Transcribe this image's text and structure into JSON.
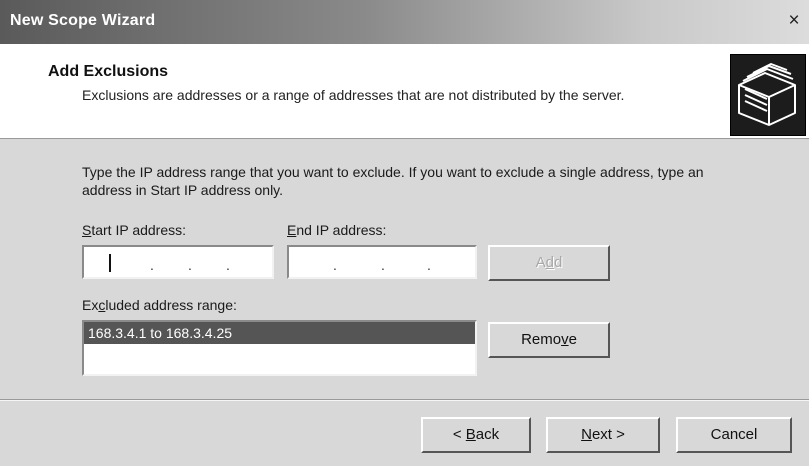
{
  "window": {
    "title": "New Scope Wizard",
    "close": "×"
  },
  "header": {
    "title": "Add Exclusions",
    "description": "Exclusions are addresses or a range of addresses that are not distributed by the server.",
    "icon": "folders-icon"
  },
  "instructions": "Type the IP address range that you want to exclude. If you want to exclude a single address, type an address in Start IP address only.",
  "start_ip": {
    "label_mnemonic": "S",
    "label_rest": "tart IP address:",
    "value": ""
  },
  "end_ip": {
    "label_mnemonic": "E",
    "label_rest": "nd IP address:",
    "value": ""
  },
  "add_button": {
    "pre": "A",
    "mnemonic": "d",
    "post": "d",
    "enabled": false
  },
  "excluded": {
    "label_pre": "Ex",
    "label_mnemonic": "c",
    "label_post": "luded address range:",
    "items": [
      "168.3.4.1 to 168.3.4.25"
    ],
    "selected_index": 0
  },
  "remove_button": {
    "pre": "Remo",
    "mnemonic": "v",
    "post": "e"
  },
  "footer": {
    "back": {
      "pre": "< ",
      "mnemonic": "B",
      "post": "ack"
    },
    "next": {
      "mnemonic": "N",
      "post": "ext >"
    },
    "cancel": "Cancel"
  },
  "colors": {
    "selection": "#555555",
    "dialog_bg": "#d8d8d8",
    "header_bg": "#ffffff"
  }
}
